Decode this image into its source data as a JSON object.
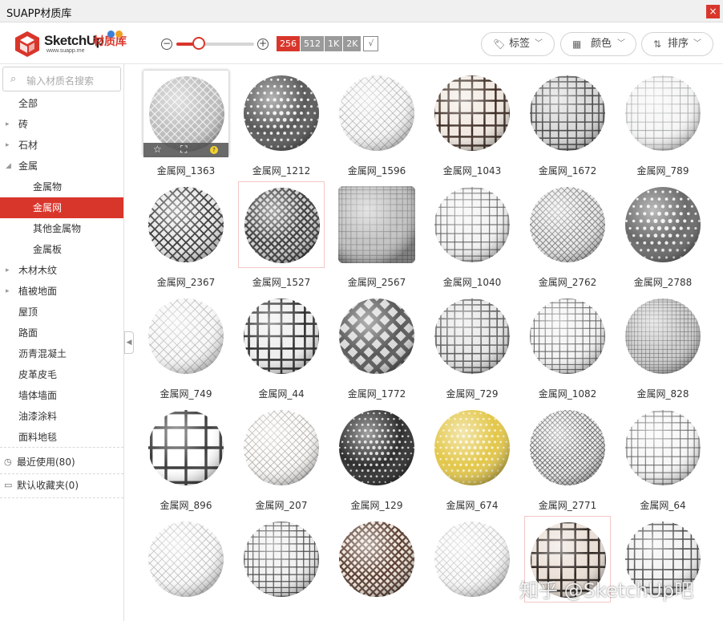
{
  "window": {
    "title": "SUAPP材质库",
    "close_label": "×"
  },
  "header": {
    "logo": {
      "brand": "SketchUp",
      "brand_cn": "材质库",
      "url": "www.suapp.me"
    },
    "zoom_out_label": "−",
    "zoom_in_label": "+",
    "zoom_level": 0.29,
    "resolutions": [
      "256",
      "512",
      "1K",
      "2K"
    ],
    "active_resolution": "256",
    "tags_label": "标签",
    "color_label": "颜色",
    "sort_label": "排序"
  },
  "sidebar": {
    "search_placeholder": "输入材质名搜索",
    "categories": [
      {
        "label": "全部",
        "expandable": false,
        "level": 0
      },
      {
        "label": "砖",
        "expandable": true,
        "level": 0
      },
      {
        "label": "石材",
        "expandable": true,
        "level": 0
      },
      {
        "label": "金属",
        "expandable": true,
        "expanded": true,
        "level": 0
      },
      {
        "label": "金属物",
        "level": 1
      },
      {
        "label": "金属网",
        "level": 1,
        "active": true
      },
      {
        "label": "其他金属物",
        "level": 1
      },
      {
        "label": "金属板",
        "level": 1
      },
      {
        "label": "木材木纹",
        "expandable": true,
        "level": 0
      },
      {
        "label": "植被地面",
        "expandable": true,
        "level": 0
      },
      {
        "label": "屋顶",
        "level": 0
      },
      {
        "label": "路面",
        "level": 0
      },
      {
        "label": "沥青混凝土",
        "level": 0
      },
      {
        "label": "皮革皮毛",
        "level": 0
      },
      {
        "label": "墙体墙面",
        "level": 0
      },
      {
        "label": "油漆涂料",
        "level": 0
      },
      {
        "label": "面料地毯",
        "level": 0
      }
    ],
    "recent_label": "最近使用(80)",
    "favorites_label": "默认收藏夹(0)"
  },
  "materials": [
    {
      "name": "金属网_1363",
      "selected": true
    },
    {
      "name": "金属网_1212"
    },
    {
      "name": "金属网_1596"
    },
    {
      "name": "金属网_1043"
    },
    {
      "name": "金属网_1672"
    },
    {
      "name": "金属网_789"
    },
    {
      "name": "金属网_2367"
    },
    {
      "name": "金属网_1527",
      "highlight": true
    },
    {
      "name": "金属网_2567"
    },
    {
      "name": "金属网_1040"
    },
    {
      "name": "金属网_2762"
    },
    {
      "name": "金属网_2788"
    },
    {
      "name": "金属网_749"
    },
    {
      "name": "金属网_44"
    },
    {
      "name": "金属网_1772"
    },
    {
      "name": "金属网_729"
    },
    {
      "name": "金属网_1082"
    },
    {
      "name": "金属网_828"
    },
    {
      "name": "金属网_896"
    },
    {
      "name": "金属网_207"
    },
    {
      "name": "金属网_129"
    },
    {
      "name": "金属网_674"
    },
    {
      "name": "金属网_2771"
    },
    {
      "name": "金属网_64"
    },
    {
      "name": ""
    },
    {
      "name": ""
    },
    {
      "name": ""
    },
    {
      "name": ""
    },
    {
      "name": "",
      "highlight": true
    },
    {
      "name": ""
    }
  ],
  "watermark": "知乎 @SketchUp吧",
  "colors": {
    "accent": "#d9362b",
    "gold": "#e3c74a"
  }
}
